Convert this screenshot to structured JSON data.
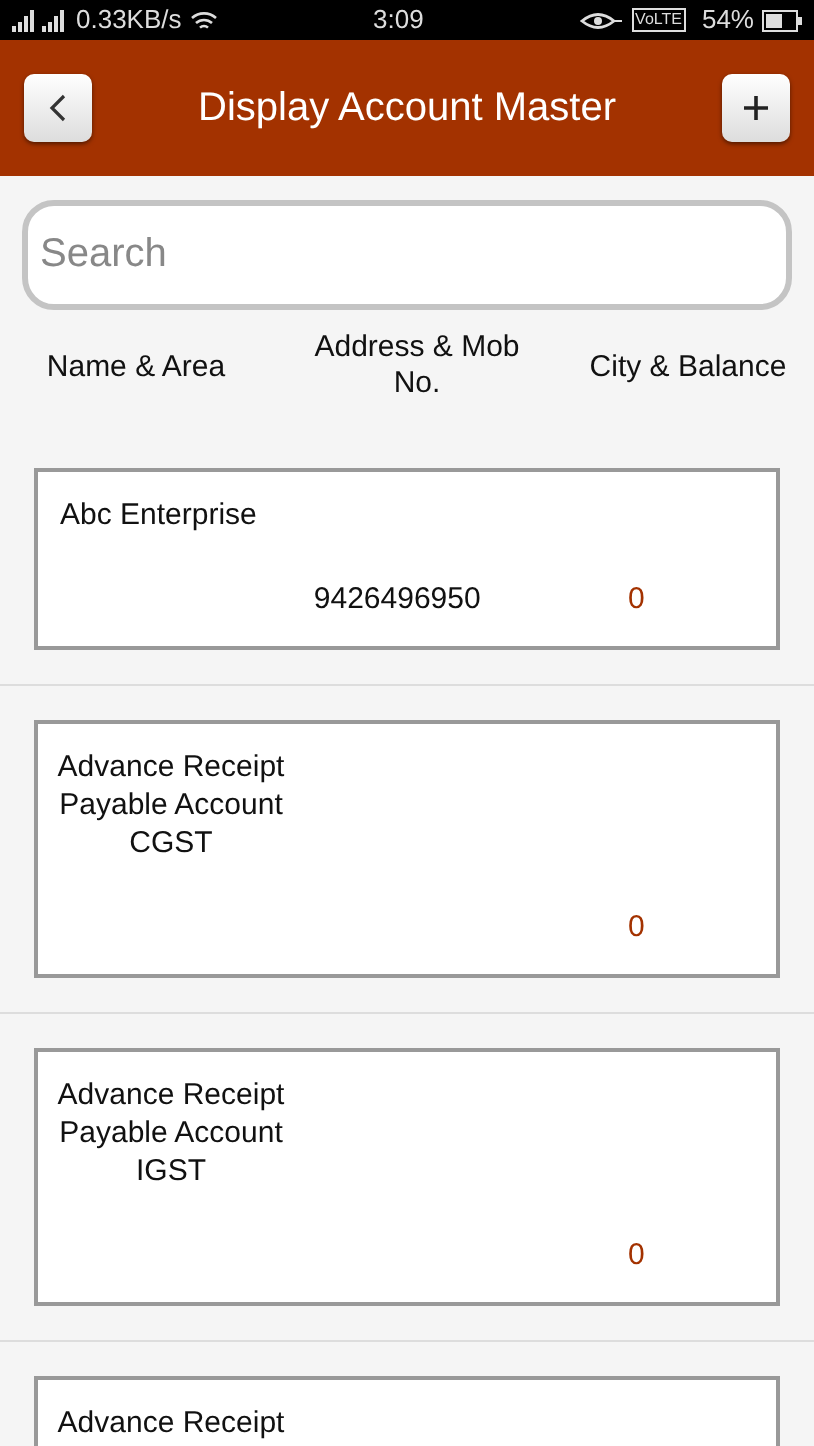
{
  "status_bar": {
    "network_speed": "0.33KB/s",
    "time": "3:09",
    "volte": "VoLTE",
    "battery": "54%"
  },
  "header": {
    "title": "Display Account Master"
  },
  "search": {
    "placeholder": "Search"
  },
  "columns": [
    "Name & Area",
    "Address & Mob No.",
    "City & Balance"
  ],
  "accounts": [
    {
      "name": "Abc Enterprise",
      "mobile": "9426496950",
      "balance": "0"
    },
    {
      "name": "Advance Receipt Payable Account CGST",
      "balance": "0"
    },
    {
      "name": "Advance Receipt Payable Account IGST",
      "balance": "0"
    },
    {
      "name": "Advance Receipt"
    }
  ]
}
